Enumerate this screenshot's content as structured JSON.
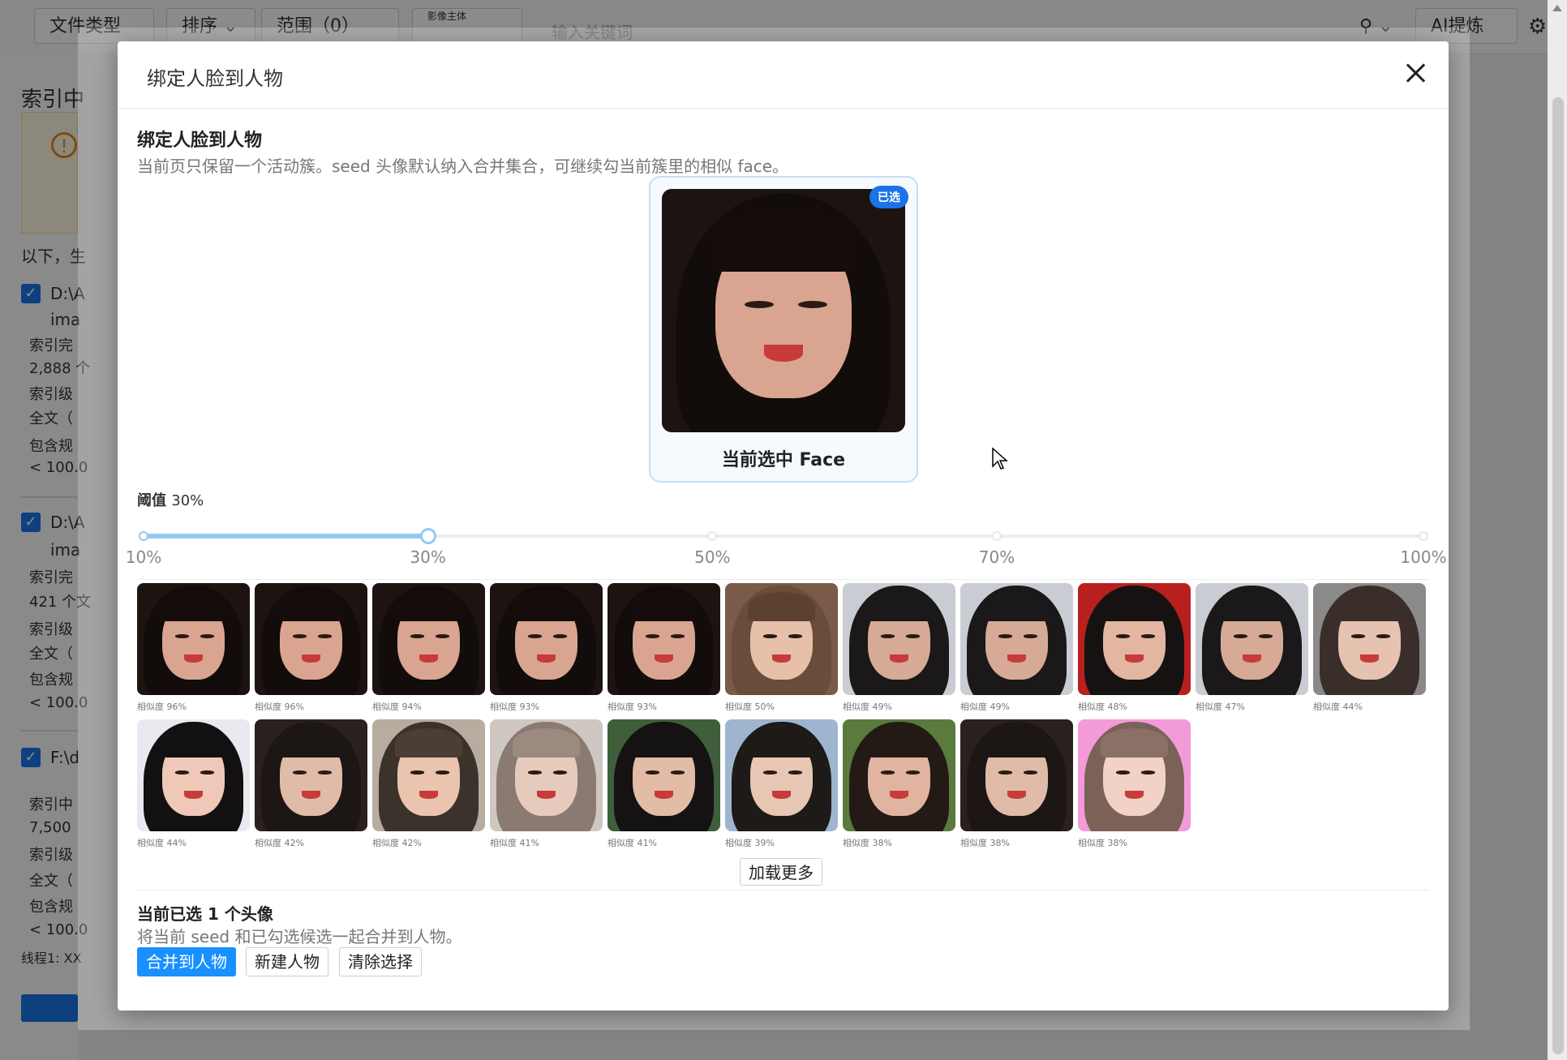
{
  "background": {
    "toolbar": {
      "file_type_label": "文件类型",
      "sort_label": "排序",
      "range_label": "范围（0）",
      "subject_label": "影像主体",
      "search_placeholder": "输入关键词",
      "ai_button_label": "AI提炼"
    },
    "sidebar": {
      "title": "索引中",
      "intro": "以下，生",
      "items": [
        {
          "path": "D:\\A",
          "sub": "ima",
          "lines": [
            "索引完",
            "2,888 个",
            "索引级",
            "全文（",
            "包含规",
            "< 100.0"
          ]
        },
        {
          "path": "D:\\A",
          "sub": "ima",
          "lines": [
            "索引完",
            "421 个文",
            "索引级",
            "全文（",
            "包含规",
            "< 100.0"
          ]
        },
        {
          "path": "F:\\d",
          "sub": "",
          "lines": [
            "索引中",
            "7,500 ",
            "索引级",
            "全文（",
            "包含规",
            "< 100.0"
          ]
        }
      ],
      "footer": "线程1: XX"
    }
  },
  "modal": {
    "title": "绑定人脸到人物",
    "section_title": "绑定人脸到人物",
    "section_desc": "当前页只保留一个活动簇。seed 头像默认纳入合并集合，可继续勾当前簇里的相似 face。",
    "seed": {
      "badge": "已选",
      "label": "当前选中 Face"
    },
    "threshold": {
      "label": "阈值",
      "value_text": "30%",
      "value": 30,
      "min": 10,
      "max": 100,
      "marks": [
        "10%",
        "30%",
        "50%",
        "70%",
        "100%"
      ]
    },
    "candidates": [
      {
        "similarity": "相似度 96%",
        "palette": "seed"
      },
      {
        "similarity": "相似度 96%",
        "palette": "seed"
      },
      {
        "similarity": "相似度 94%",
        "palette": "seed"
      },
      {
        "similarity": "相似度 93%",
        "palette": "seed"
      },
      {
        "similarity": "相似度 93%",
        "palette": "seed"
      },
      {
        "similarity": "相似度 50%",
        "palette": "warm"
      },
      {
        "similarity": "相似度 49%",
        "palette": "outdoor"
      },
      {
        "similarity": "相似度 49%",
        "palette": "outdoor"
      },
      {
        "similarity": "相似度 48%",
        "palette": "red"
      },
      {
        "similarity": "相似度 47%",
        "palette": "outdoor"
      },
      {
        "similarity": "相似度 44%",
        "palette": "grey"
      },
      {
        "similarity": "相似度 44%",
        "palette": "pillow"
      },
      {
        "similarity": "相似度 42%",
        "palette": "dark"
      },
      {
        "similarity": "相似度 42%",
        "palette": "light"
      },
      {
        "similarity": "相似度 41%",
        "palette": "blur"
      },
      {
        "similarity": "相似度 41%",
        "palette": "tree"
      },
      {
        "similarity": "相似度 39%",
        "palette": "sky"
      },
      {
        "similarity": "相似度 38%",
        "palette": "garden"
      },
      {
        "similarity": "相似度 38%",
        "palette": "dark"
      },
      {
        "similarity": "相似度 38%",
        "palette": "pink"
      }
    ],
    "load_more_label": "加载更多",
    "selection": {
      "title": "当前已选 1 个头像",
      "desc": "将当前 seed 和已勾选候选一起合并到人物。"
    },
    "buttons": {
      "merge": "合并到人物",
      "new_person": "新建人物",
      "clear": "清除选择"
    }
  },
  "colors": {
    "primary": "#1890ff",
    "badge": "#1a73e8",
    "slider": "#91caf2"
  }
}
